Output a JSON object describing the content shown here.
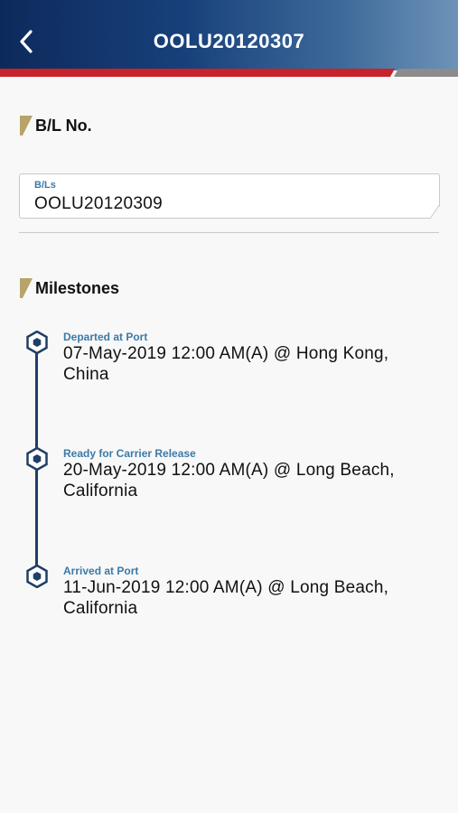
{
  "header": {
    "title": "OOLU20120307",
    "back_icon": "chevron-left-icon",
    "gradient": [
      "#0e2a5c",
      "#6e93b9"
    ],
    "stripe_colors": [
      "#c8222b",
      "#8c8c8c"
    ]
  },
  "bl_section": {
    "title": "B/L No.",
    "field_label": "B/Ls",
    "field_value": "OOLU20120309"
  },
  "milestones_section": {
    "title": "Milestones",
    "items": [
      {
        "label": "Departed at Port",
        "value": "07-May-2019 12:00 AM(A) @ Hong Kong, China"
      },
      {
        "label": "Ready for Carrier Release",
        "value": "20-May-2019 12:00 AM(A) @ Long Beach, California"
      },
      {
        "label": "Arrived at Port",
        "value": "11-Jun-2019 12:00 AM(A) @ Long Beach, California"
      }
    ]
  },
  "colors": {
    "accent_gold": "#b8a46a",
    "label_blue": "#3b7aa6",
    "timeline_navy": "#1f3f66"
  }
}
